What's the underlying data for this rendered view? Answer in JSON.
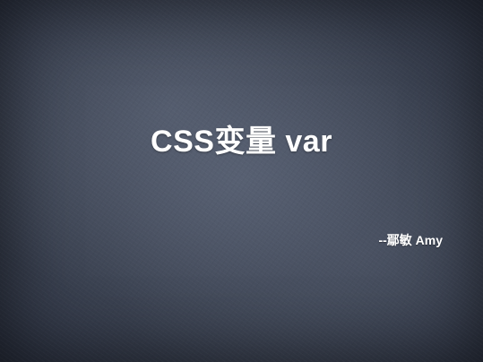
{
  "slide": {
    "title": "CSS变量 var",
    "author": "--鄢敏 Amy"
  }
}
